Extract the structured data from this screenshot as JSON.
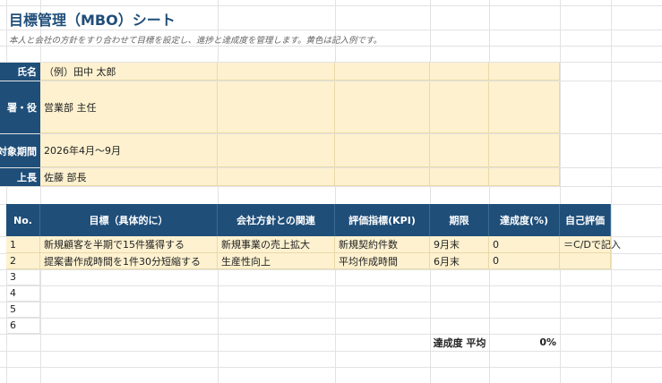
{
  "sheet": {
    "title": "目標管理（MBO）シート",
    "subtitle": "本人と会社の方針をすり合わせて目標を設定し、進捗と達成度を管理します。黄色は記入例です。"
  },
  "info": [
    {
      "label": "氏名",
      "value": "（例）田中 太郎"
    },
    {
      "label": "署・役",
      "value": "営業部 主任"
    },
    {
      "label": "対象期間",
      "value": "2026年4月〜9月"
    },
    {
      "label": "上長",
      "value": "佐藤 部長"
    }
  ],
  "table": {
    "headers": [
      "No.",
      "目標（具体的に）",
      "会社方針との関連",
      "評価指標(KPI)",
      "期限",
      "達成度(%)",
      "自己評価"
    ],
    "rows": [
      {
        "no": "1",
        "goal": "新規顧客を半期で15件獲得する",
        "policy": "新規事業の売上拡大",
        "kpi": "新規契約件数",
        "due": "9月末",
        "pct": "0",
        "self": "＝C/Dで記入"
      },
      {
        "no": "2",
        "goal": "提案書作成時間を1件30分短縮する",
        "policy": "生産性向上",
        "kpi": "平均作成時間",
        "due": "6月末",
        "pct": "0",
        "self": ""
      },
      {
        "no": "3",
        "goal": "",
        "policy": "",
        "kpi": "",
        "due": "",
        "pct": "",
        "self": ""
      },
      {
        "no": "4",
        "goal": "",
        "policy": "",
        "kpi": "",
        "due": "",
        "pct": "",
        "self": ""
      },
      {
        "no": "5",
        "goal": "",
        "policy": "",
        "kpi": "",
        "due": "",
        "pct": "",
        "self": ""
      },
      {
        "no": "6",
        "goal": "",
        "policy": "",
        "kpi": "",
        "due": "",
        "pct": "",
        "self": ""
      }
    ]
  },
  "summary": {
    "label": "達成度 平均",
    "value": "0%"
  },
  "colors": {
    "header": "#1f4e79",
    "input": "#fdf1cf"
  }
}
